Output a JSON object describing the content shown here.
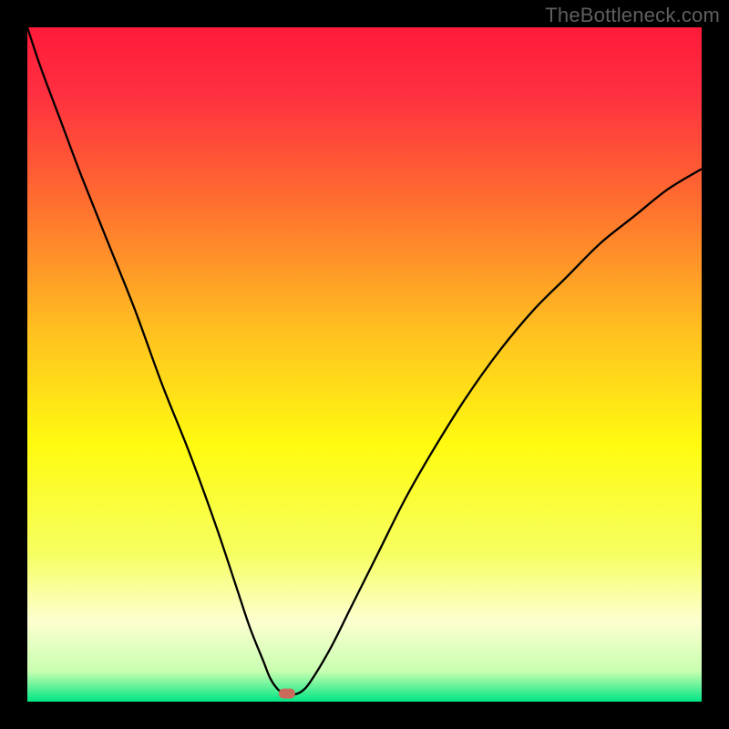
{
  "watermark": "TheBottleneck.com",
  "chart_data": {
    "type": "line",
    "title": "",
    "xlabel": "",
    "ylabel": "",
    "xlim": [
      0,
      100
    ],
    "ylim": [
      0,
      100
    ],
    "grid": false,
    "background_gradient": {
      "stops": [
        {
          "offset": 0.0,
          "color": "#ff1a3a"
        },
        {
          "offset": 0.1,
          "color": "#ff3040"
        },
        {
          "offset": 0.25,
          "color": "#ff6a30"
        },
        {
          "offset": 0.45,
          "color": "#ffc020"
        },
        {
          "offset": 0.62,
          "color": "#fffb10"
        },
        {
          "offset": 0.78,
          "color": "#f6ff60"
        },
        {
          "offset": 0.88,
          "color": "#fdffd0"
        },
        {
          "offset": 0.955,
          "color": "#c8ffb0"
        },
        {
          "offset": 1.0,
          "color": "#00e584"
        }
      ]
    },
    "series": [
      {
        "name": "bottleneck-curve",
        "color": "#000000",
        "x": [
          0,
          2,
          5,
          8,
          12,
          16,
          20,
          24,
          28,
          31,
          33,
          35,
          36,
          37,
          38,
          39,
          40.5,
          42,
          45,
          48,
          52,
          56,
          60,
          65,
          70,
          75,
          80,
          85,
          90,
          95,
          100
        ],
        "y": [
          100,
          94,
          86,
          78,
          68,
          58,
          47,
          37,
          26,
          17,
          11,
          6,
          3.5,
          2,
          1.2,
          1,
          1.4,
          3,
          8,
          14,
          22,
          30,
          37,
          45,
          52,
          58,
          63,
          68,
          72,
          76,
          79
        ]
      }
    ],
    "optimal_marker": {
      "x": 38.5,
      "y": 1.2,
      "color": "#c96a5a"
    }
  }
}
